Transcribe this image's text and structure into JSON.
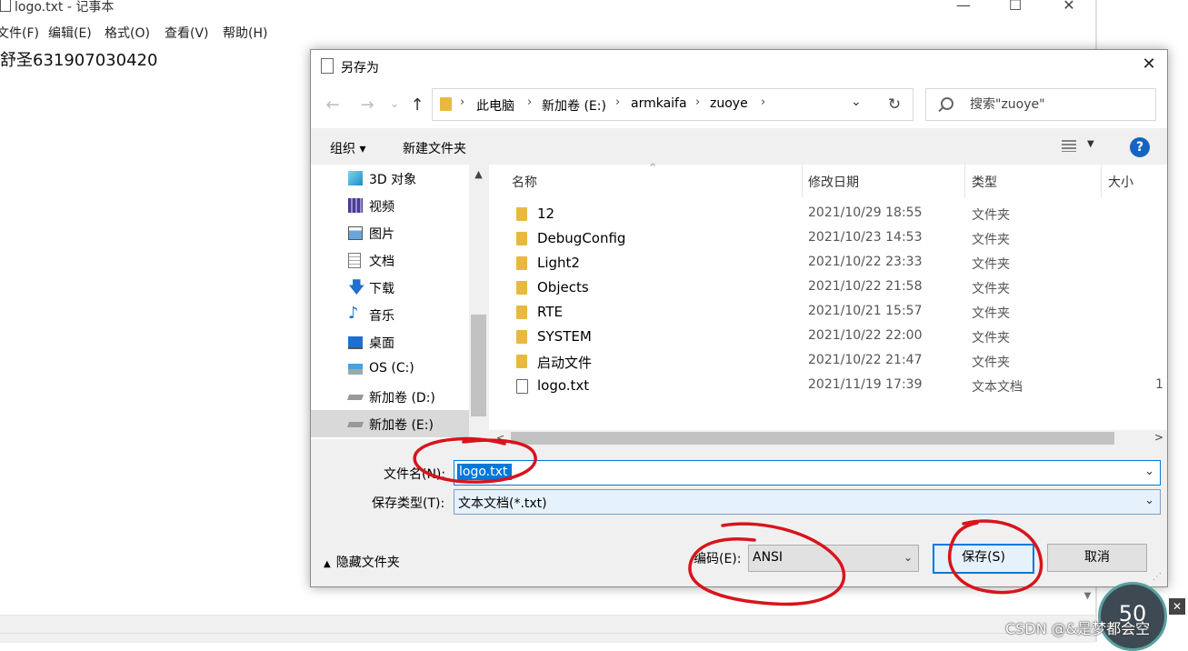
{
  "notepad": {
    "title": "logo.txt - 记事本",
    "win_min": "—",
    "win_max": "☐",
    "win_close": "✕",
    "menu": [
      "文件(F)",
      "编辑(E)",
      "格式(O)",
      "查看(V)",
      "帮助(H)"
    ],
    "content": "舒圣631907030420"
  },
  "dialog": {
    "title": "另存为",
    "close": "✕",
    "nav": {
      "back": "←",
      "forward": "→",
      "recent": "⌄",
      "up": "↑"
    },
    "address": [
      "此电脑",
      "新加卷 (E:)",
      "armkaifa",
      "zuoye"
    ],
    "address_sep": "›",
    "refresh": "↻",
    "search_placeholder": "搜索\"zuoye\"",
    "toolbar": {
      "organize": "组织 ▾",
      "new_folder": "新建文件夹",
      "help": "?"
    },
    "nav_pane": [
      {
        "label": "3D 对象",
        "icon": "cube-3d-icon",
        "color": "#2fa7d8"
      },
      {
        "label": "视频",
        "icon": "video-icon",
        "color": "#4a3b8f"
      },
      {
        "label": "图片",
        "icon": "pictures-icon",
        "color": "#3a78b5"
      },
      {
        "label": "文档",
        "icon": "documents-icon",
        "color": "#8a8a8a"
      },
      {
        "label": "下载",
        "icon": "download-icon",
        "color": "#1e6fd0"
      },
      {
        "label": "音乐",
        "icon": "music-icon",
        "color": "#1e6fd0"
      },
      {
        "label": "桌面",
        "icon": "desktop-icon",
        "color": "#1e6fd0"
      },
      {
        "label": "OS (C:)",
        "icon": "drive-c-icon",
        "color": "#5b8fb9"
      },
      {
        "label": "新加卷 (D:)",
        "icon": "drive-icon",
        "color": "#777777"
      },
      {
        "label": "新加卷 (E:)",
        "icon": "drive-icon",
        "color": "#777777"
      }
    ],
    "columns": [
      "名称",
      "修改日期",
      "类型",
      "大小"
    ],
    "files": [
      {
        "name": "12",
        "date": "2021/10/29 18:55",
        "type": "文件夹",
        "size": "",
        "kind": "folder"
      },
      {
        "name": "DebugConfig",
        "date": "2021/10/23 14:53",
        "type": "文件夹",
        "size": "",
        "kind": "folder"
      },
      {
        "name": "Light2",
        "date": "2021/10/22 23:33",
        "type": "文件夹",
        "size": "",
        "kind": "folder"
      },
      {
        "name": "Objects",
        "date": "2021/10/22 21:58",
        "type": "文件夹",
        "size": "",
        "kind": "folder"
      },
      {
        "name": "RTE",
        "date": "2021/10/21 15:57",
        "type": "文件夹",
        "size": "",
        "kind": "folder"
      },
      {
        "name": "SYSTEM",
        "date": "2021/10/22 22:00",
        "type": "文件夹",
        "size": "",
        "kind": "folder"
      },
      {
        "name": "启动文件",
        "date": "2021/10/22 21:47",
        "type": "文件夹",
        "size": "",
        "kind": "folder"
      },
      {
        "name": "logo.txt",
        "date": "2021/11/19 17:39",
        "type": "文本文档",
        "size": "1",
        "kind": "txt"
      }
    ],
    "filename_label": "文件名(N):",
    "filename_value": "logo.txt",
    "filetype_label": "保存类型(T):",
    "filetype_value": "文本文档(*.txt)",
    "hide_folders": "隐藏文件夹",
    "encoding_label": "编码(E):",
    "encoding_value": "ANSI",
    "save": "保存(S)",
    "cancel": "取消"
  },
  "overlay": {
    "speed_value": "50",
    "watermark": "CSDN @&是梦都会空",
    "annotation_color": "#d8141c"
  }
}
